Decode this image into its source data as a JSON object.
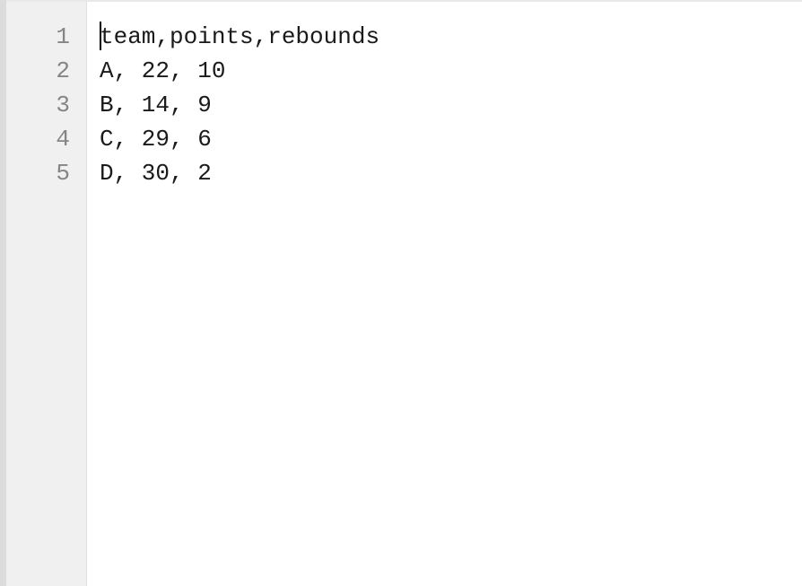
{
  "editor": {
    "lines": [
      {
        "num": "1",
        "text": "team,points,rebounds"
      },
      {
        "num": "2",
        "text": "A, 22, 10"
      },
      {
        "num": "3",
        "text": "B, 14, 9"
      },
      {
        "num": "4",
        "text": "C, 29, 6"
      },
      {
        "num": "5",
        "text": "D, 30, 2"
      }
    ]
  }
}
